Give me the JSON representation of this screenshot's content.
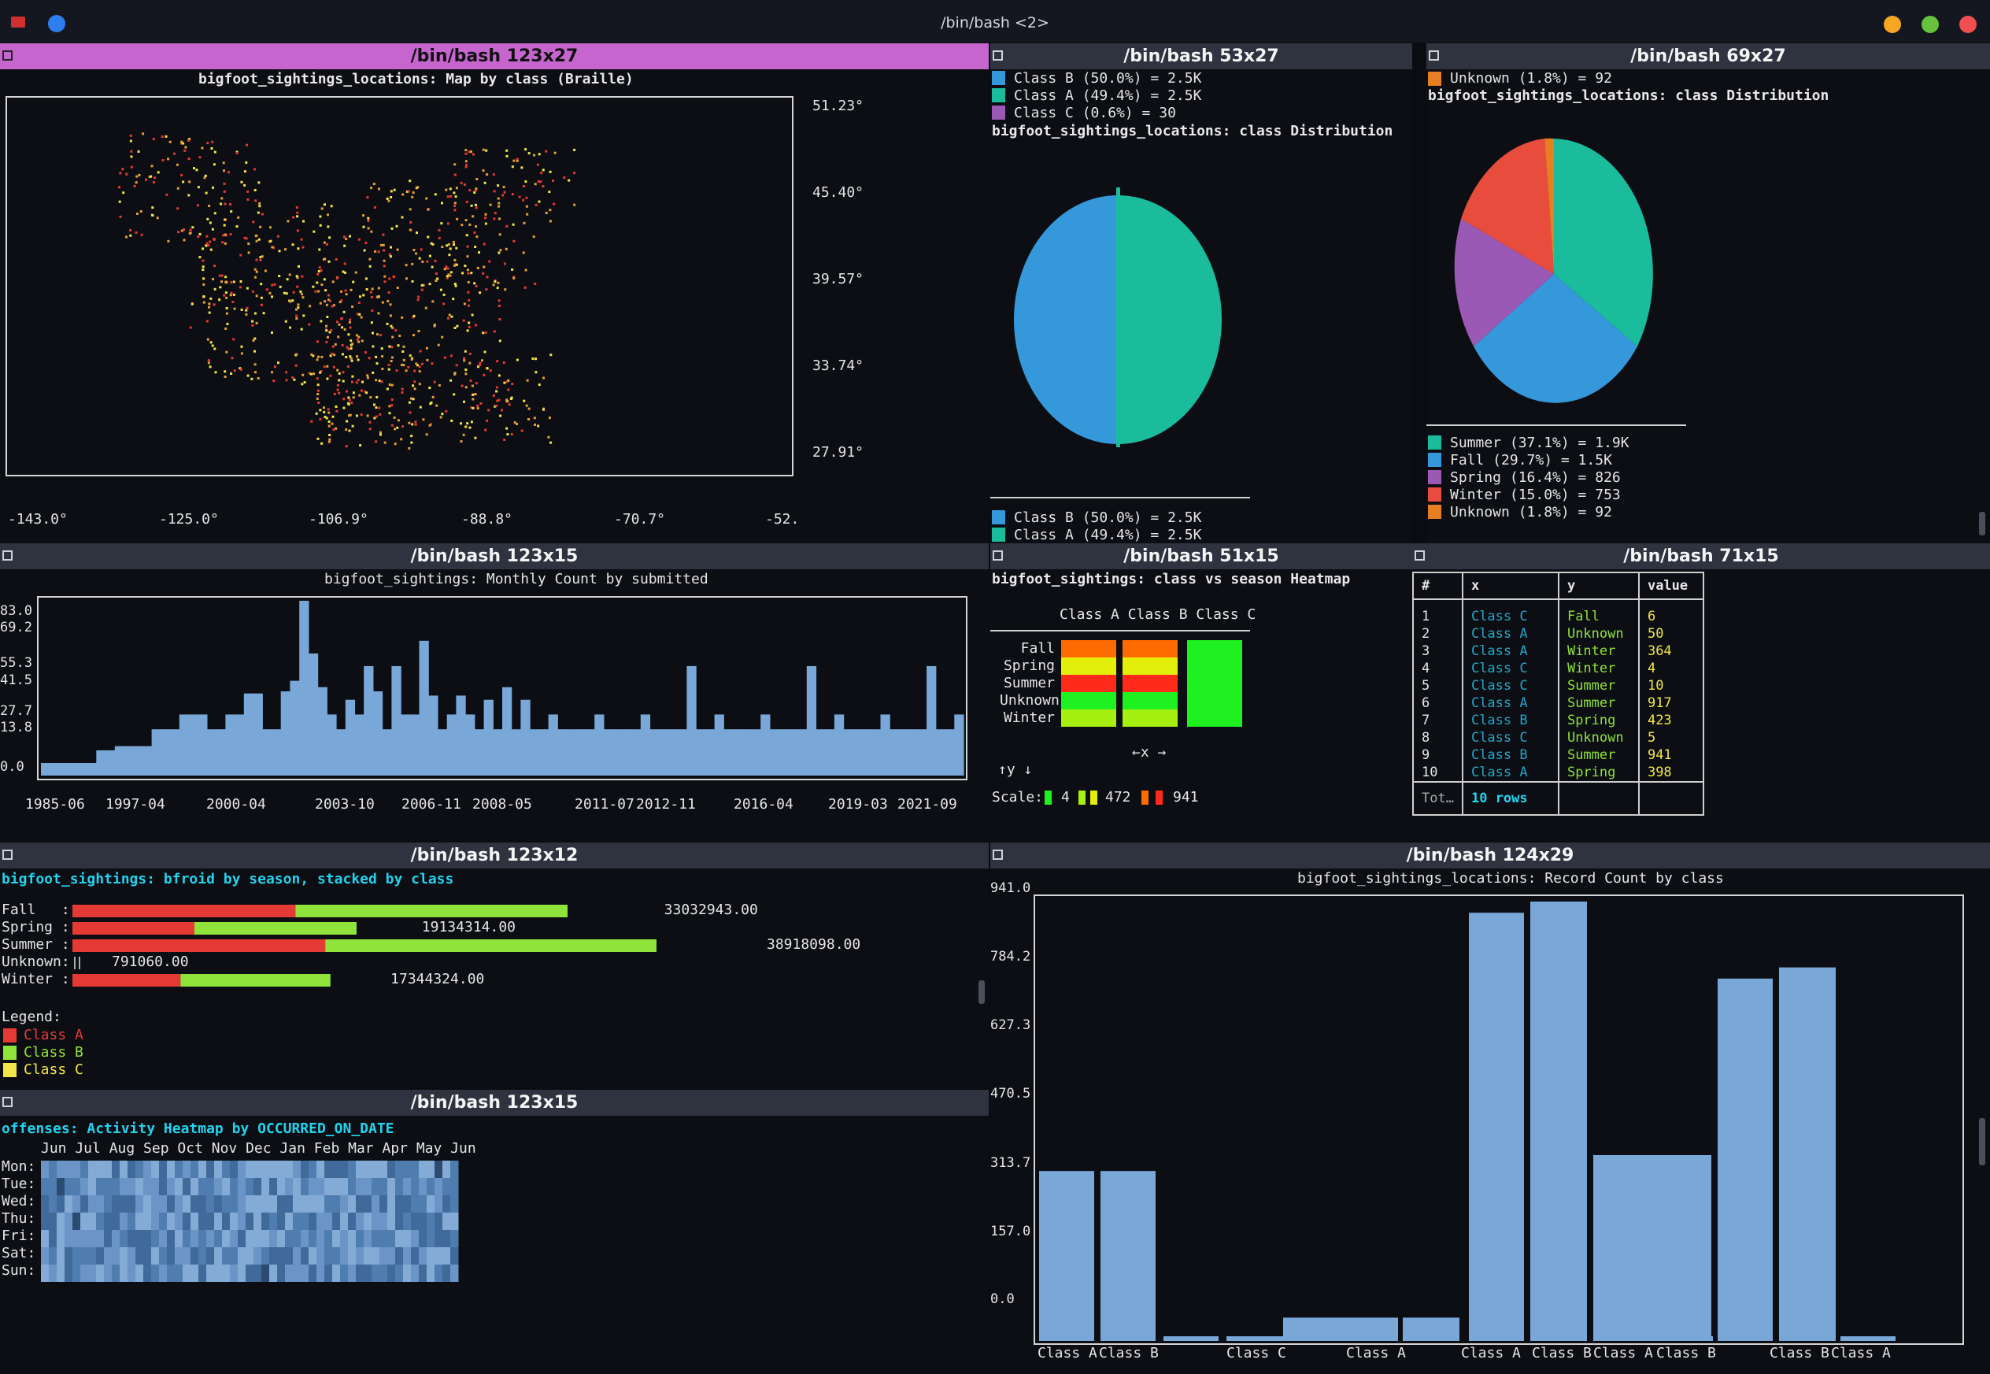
{
  "window": {
    "title": "/bin/bash <2>"
  },
  "panes": {
    "map": {
      "title": "/bin/bash 123x27",
      "chart_title": "bigfoot_sightings_locations: Map by class (Braille)",
      "lat_ticks": [
        "51.23°",
        "45.40°",
        "39.57°",
        "33.74°",
        "27.91°"
      ],
      "lon_ticks": [
        "-143.0°",
        "-125.0°",
        "-106.9°",
        "-88.8°",
        "-70.7°",
        "-52."
      ]
    },
    "pie_class": {
      "title": "/bin/bash 53x27",
      "chart_title": "bigfoot_sightings_locations: class Distribution",
      "legend": [
        {
          "label": "Class B (50.0%) = 2.5K",
          "color": "#3498db"
        },
        {
          "label": "Class A (49.4%) = 2.5K",
          "color": "#1abc9c"
        },
        {
          "label": "Class C (0.6%) = 30",
          "color": "#9b59b6"
        }
      ]
    },
    "pie_season": {
      "title": "/bin/bash 69x27",
      "chart_title": "bigfoot_sightings_locations: class Distribution",
      "top_legend": "Unknown (1.8%) = 92",
      "legend": [
        {
          "label": "Summer (37.1%) = 1.9K",
          "color": "#1abc9c"
        },
        {
          "label": "Fall (29.7%) = 1.5K",
          "color": "#3498db"
        },
        {
          "label": "Spring (16.4%) = 826",
          "color": "#9b59b6"
        },
        {
          "label": "Winter (15.0%) = 753",
          "color": "#e74c3c"
        },
        {
          "label": "Unknown (1.8%) = 92",
          "color": "#e67e22"
        }
      ]
    },
    "monthly": {
      "title": "/bin/bash 123x15",
      "chart_title": "bigfoot_sightings: Monthly Count by submitted",
      "y_ticks": [
        "83.0",
        "69.2",
        "55.3",
        "41.5",
        "27.7",
        "13.8",
        "0.0"
      ],
      "x_ticks": [
        "1985-06",
        "1997-04",
        "2000-04",
        "2003-10",
        "2006-11",
        "2008-05",
        "2011-07",
        "2012-11",
        "2016-04",
        "2019-03",
        "2021-09"
      ]
    },
    "heatmap": {
      "title": "/bin/bash 51x15",
      "chart_title": "bigfoot_sightings: class vs season Heatmap",
      "col_header": "Class A Class B Class C",
      "rows": [
        "Fall",
        "Spring",
        "Summer",
        "Unknown",
        "Winter"
      ],
      "x_arrow": "←x →",
      "y_arrow": "↑y ↓",
      "scale_label": "Scale:",
      "scale_values": [
        "4",
        "472",
        "941"
      ]
    },
    "table": {
      "title": "/bin/bash 71x15",
      "headers": [
        "#",
        "x",
        "y",
        "value"
      ],
      "rows": [
        [
          "1",
          "Class C",
          "Fall",
          "6"
        ],
        [
          "2",
          "Class A",
          "Unknown",
          "50"
        ],
        [
          "3",
          "Class A",
          "Winter",
          "364"
        ],
        [
          "4",
          "Class C",
          "Winter",
          "4"
        ],
        [
          "5",
          "Class C",
          "Summer",
          "10"
        ],
        [
          "6",
          "Class A",
          "Summer",
          "917"
        ],
        [
          "7",
          "Class B",
          "Spring",
          "423"
        ],
        [
          "8",
          "Class C",
          "Unknown",
          "5"
        ],
        [
          "9",
          "Class B",
          "Summer",
          "941"
        ],
        [
          "10",
          "Class A",
          "Spring",
          "398"
        ]
      ],
      "footer_label": "Tot…",
      "footer_value": "10 rows"
    },
    "stacked": {
      "title": "/bin/bash 123x12",
      "chart_title": "bigfoot_sightings: bfroid by season, stacked by class",
      "legend_title": "Legend:",
      "legend": [
        {
          "label": "Class A",
          "color": "#e53935"
        },
        {
          "label": "Class B",
          "color": "#8fe33a"
        },
        {
          "label": "Class C",
          "color": "#f3e64a"
        }
      ]
    },
    "activity": {
      "title": "/bin/bash 123x15",
      "chart_title": "offenses: Activity Heatmap by OCCURRED_ON_DATE",
      "months": "Jun Jul Aug Sep Oct Nov Dec Jan Feb Mar Apr May Jun",
      "days": [
        "Mon:",
        "Tue:",
        "Wed:",
        "Thu:",
        "Fri:",
        "Sat:",
        "Sun:"
      ]
    },
    "record": {
      "title": "/bin/bash 124x29",
      "chart_title": "bigfoot_sightings_locations: Record Count by class",
      "y_ticks": [
        "941.0",
        "784.2",
        "627.3",
        "470.5",
        "313.7",
        "157.0",
        "0.0"
      ]
    }
  },
  "chart_data": [
    {
      "type": "bar",
      "title": "bigfoot_sightings: bfroid by season, stacked by class",
      "categories": [
        "Fall",
        "Spring",
        "Summer",
        "Unknown",
        "Winter"
      ],
      "series": [
        {
          "name": "Class A",
          "values": [
            12800000,
            7000000,
            14500000,
            0,
            6200000
          ]
        },
        {
          "name": "Class B",
          "values": [
            15600000,
            9300000,
            19000000,
            0,
            8600000
          ]
        },
        {
          "name": "Class C",
          "values": [
            0,
            0,
            0,
            0,
            0
          ]
        }
      ],
      "totals": [
        33032943.0,
        19134314.0,
        38918098.0,
        791060.0,
        17344324.0
      ],
      "total_labels": [
        "33032943.00",
        "19134314.00",
        "38918098.00",
        "791060.00",
        "17344324.00"
      ]
    },
    {
      "type": "bar",
      "title": "bigfoot_sightings_locations: Record Count by class",
      "categories": [
        "Class A",
        "Class B",
        "Class C",
        "Class C",
        "Class A",
        "Class A",
        "Class A",
        "Class B",
        "Class A",
        "Class B",
        "Class B",
        "Class A",
        "Class A"
      ],
      "x_tick_labels": [
        "Class A",
        "Class B",
        "Class C",
        "Class A",
        "Class A",
        "Class B",
        "Class A",
        "Class B",
        "Class B",
        "Class A"
      ],
      "values": [
        364,
        364,
        10,
        10,
        50,
        50,
        917,
        941,
        398,
        10,
        776,
        800,
        10
      ],
      "ylim": [
        0,
        941
      ]
    },
    {
      "type": "bar",
      "title": "bigfoot_sightings: Monthly Count by submitted",
      "values": [
        6,
        6,
        6,
        6,
        6,
        6,
        12,
        12,
        14,
        14,
        14,
        14,
        22,
        22,
        22,
        29,
        29,
        29,
        22,
        22,
        29,
        29,
        39,
        39,
        22,
        22,
        40,
        45,
        83,
        58,
        42,
        29,
        22,
        36,
        29,
        52,
        40,
        22,
        52,
        29,
        29,
        64,
        38,
        22,
        29,
        38,
        29,
        22,
        36,
        22,
        42,
        22,
        36,
        22,
        22,
        29,
        22,
        22,
        22,
        22,
        29,
        22,
        22,
        22,
        22,
        29,
        22,
        22,
        22,
        22,
        52,
        22,
        22,
        29,
        22,
        22,
        22,
        22,
        29,
        22,
        22,
        22,
        22,
        52,
        22,
        22,
        29,
        22,
        22,
        22,
        22,
        29,
        22,
        22,
        22,
        22,
        52,
        22,
        22,
        29
      ],
      "ylim": [
        0,
        83
      ]
    }
  ]
}
